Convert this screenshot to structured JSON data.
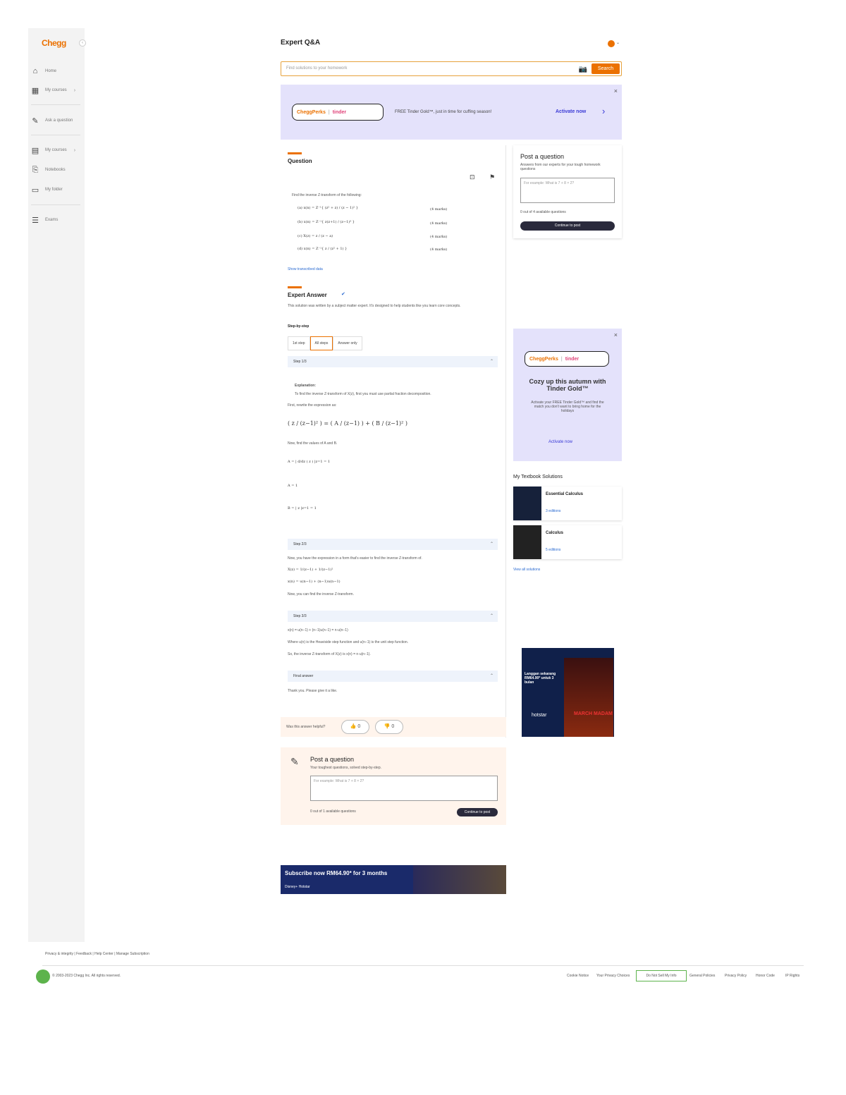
{
  "app": {
    "logo": "Chegg",
    "collapse_icon": "chevron-left-icon"
  },
  "sidebar": {
    "items": [
      {
        "label": "Home",
        "icon": "home-icon"
      },
      {
        "label": "My courses",
        "icon": "grid-icon"
      },
      {
        "label": "Ask a question",
        "icon": "ask-icon"
      },
      {
        "label": "My courses",
        "icon": "books-icon"
      },
      {
        "label": "Notebooks",
        "icon": "notebook-icon"
      },
      {
        "label": "My folder",
        "icon": "folder-icon"
      },
      {
        "label": "Exams",
        "icon": "exam-icon"
      }
    ]
  },
  "header": {
    "title": "Expert Q&A"
  },
  "search": {
    "placeholder": "Find solutions to your homework",
    "button": "Search"
  },
  "promo_banner": {
    "brand_left": "CheggPerks",
    "brand_right": "tinder",
    "text": "FREE Tinder Gold™, just in time for cuffing season!",
    "link": "Activate now"
  },
  "question": {
    "heading": "Question",
    "prompt": "Find the inverse Z-transform of the following:",
    "parts": [
      {
        "expr": "(a) x(n) = Z⁻¹{ (z² + z) / (z − 1)² }",
        "marks": "(4 marks)"
      },
      {
        "expr": "(b) x(n) = Z⁻¹{ z(z+1) / (z−1)³ }",
        "marks": "(4 marks)"
      },
      {
        "expr": "(c) X(z) = z / (z − a)",
        "marks": "(4 marks)"
      },
      {
        "expr": "(d) x(n) = Z⁻¹{ z / (z² + 1) }",
        "marks": "(4 marks)"
      }
    ],
    "show_link": "Show transcribed data"
  },
  "answer": {
    "heading": "Expert Answer",
    "note": "This solution was written by a subject matter expert. It's designed to help students like you learn core concepts.",
    "step_label": "Step-by-step",
    "tabs": [
      "1st step",
      "All steps",
      "Answer only"
    ],
    "steps": [
      {
        "title": "Step 1/3",
        "explanation_label": "Explanation:",
        "explanation": "To find the inverse Z-transform of X(z), first you must use partial fraction decomposition.",
        "line1": "First, rewrite the expression as:",
        "eq1": "( z / (z−1)² ) = ( A / (z−1) ) + ( B / (z−1)² )",
        "line2": "Now, find the values of A and B.",
        "eq2": "A = | d/dz ( z ) |z=1 = 1",
        "eq3": "A = 1",
        "eq4": "B = | z |z=1 = 1"
      },
      {
        "title": "Step 2/3",
        "line1": "Now, you have the expression in a form that's easier to find the inverse Z-transform of.",
        "eq1": "X(z) = 1/(z−1) + 1/(z−1)²",
        "eq2": "x(n) = u(n−1) + (n−1)u(n−1)",
        "line2": "Now, you can find the inverse Z-transform."
      },
      {
        "title": "Step 3/3",
        "line1": "x(n) = u(n−1) + (n−1)u(n−1) = n·u(n−1)",
        "line2": "Where u(n) is the Heaviside step function and u(n−1) is the unit step function.",
        "line3": "So, the inverse Z-transform of X(z) is x(n) = n·u(n−1)."
      }
    ],
    "final_title": "Final answer",
    "final_text": "Thank you. Please give it a like."
  },
  "helpful": {
    "question": "Was this answer helpful?",
    "up": "👍 0",
    "down": "👎 0"
  },
  "post_question": {
    "title": "Post a question",
    "subtitle": "Your toughest questions, solved step-by-step.",
    "placeholder": "For example: What is 7 + 8 × 2?",
    "limit": "0 out of 1 available questions",
    "button": "Continue to post"
  },
  "post_question_side": {
    "title": "Post a question",
    "subtitle": "Answers from our experts for your tough homework questions",
    "placeholder": "For example: What is 7 + 8 × 2?",
    "limit": "0 out of 4 available questions",
    "button": "Continue to post"
  },
  "side_promo": {
    "brand_left": "CheggPerks",
    "brand_right": "tinder",
    "title": "Cozy up this autumn with Tinder Gold™",
    "text": "Activate your FREE Tinder Gold™ and find the match you don't want to bring home for the holidays",
    "link": "Activate now"
  },
  "textbooks": {
    "heading": "My Textbook Solutions",
    "items": [
      {
        "title": "Essential Calculus",
        "sub": "3 editions"
      },
      {
        "title": "Calculus",
        "sub": "5 editions"
      }
    ],
    "view_all": "View all solutions"
  },
  "ads": {
    "side_text": "Langgan sekarang RM64.90* untuk 3 bulan",
    "side_brand": "hotstar",
    "side_title": "MARCH MADAM",
    "bottom_text": "Subscribe now RM64.90* for 3 months",
    "bottom_brand": "Disney+ Hotstar"
  },
  "footer": {
    "links": "Privacy & integrity  |  Feedback  |  Help Center  |  Manage Subscription",
    "copyright": "© 2003-2023 Chegg Inc. All rights reserved.",
    "right_links": [
      "Cookie Notice",
      "Your Privacy Choices",
      "Do Not Sell My Info",
      "General Policies",
      "Privacy Policy",
      "Honor Code",
      "IP Rights"
    ]
  },
  "colors": {
    "accent": "#eb7100",
    "promo_bg": "#e4e2fb",
    "link": "#2a6ad1"
  }
}
